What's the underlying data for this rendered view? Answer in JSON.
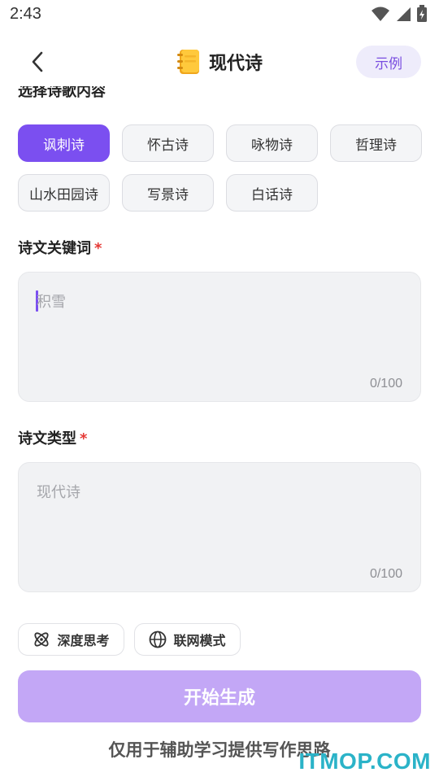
{
  "status_bar": {
    "time": "2:43"
  },
  "header": {
    "title": "现代诗",
    "example_label": "示例",
    "notebook_icon": "notebook-icon"
  },
  "section_poem_content": {
    "label": "选择诗歌内容"
  },
  "chips": [
    {
      "label": "讽刺诗",
      "selected": true
    },
    {
      "label": "怀古诗",
      "selected": false
    },
    {
      "label": "咏物诗",
      "selected": false
    },
    {
      "label": "哲理诗",
      "selected": false
    },
    {
      "label": "山水田园诗",
      "selected": false
    },
    {
      "label": "写景诗",
      "selected": false
    },
    {
      "label": "白话诗",
      "selected": false
    }
  ],
  "keywords": {
    "label": "诗文关键词",
    "required_mark": "*",
    "placeholder": "积雪",
    "counter": "0/100"
  },
  "poem_type": {
    "label": "诗文类型",
    "required_mark": "*",
    "placeholder": "现代诗",
    "counter": "0/100"
  },
  "modes": {
    "deep_think": "深度思考",
    "web_mode": "联网模式"
  },
  "generate": {
    "label": "开始生成"
  },
  "footer": {
    "note": "仅用于辅助学习提供写作思路"
  },
  "watermark": {
    "text": "ITMOP.COM"
  },
  "colors": {
    "accent": "#7b4ff0",
    "button_disabled": "#c3a7f6",
    "required": "#e53935"
  }
}
